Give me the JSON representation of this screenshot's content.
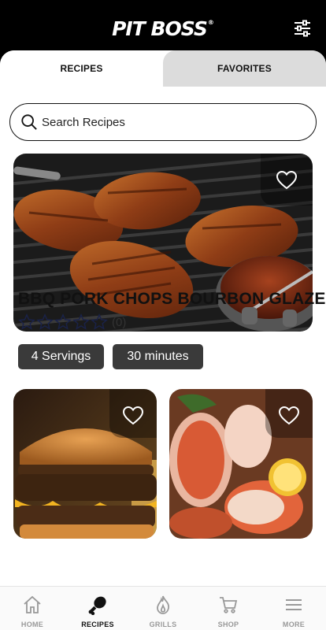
{
  "header": {
    "logo_text": "PIT BOSS",
    "logo_mark": "®",
    "filter_icon": "sliders-icon"
  },
  "tabs": [
    {
      "label": "RECIPES",
      "active": true
    },
    {
      "label": "FAVORITES",
      "active": false
    }
  ],
  "search": {
    "placeholder": "Search Recipes",
    "value": ""
  },
  "featured": {
    "title": "BBQ PORK CHOPS BOURBON GLAZE",
    "rating_count": "(0)",
    "stars": 0,
    "servings": "4 Servings",
    "time": "30 minutes",
    "favorited": false
  },
  "cards": [
    {
      "image": "burger",
      "favorited": false
    },
    {
      "image": "lobster",
      "favorited": false
    }
  ],
  "bottom_nav": [
    {
      "label": "HOME",
      "icon": "home-icon",
      "active": false
    },
    {
      "label": "RECIPES",
      "icon": "drumstick-icon",
      "active": true
    },
    {
      "label": "GRILLS",
      "icon": "flame-icon",
      "active": false
    },
    {
      "label": "SHOP",
      "icon": "cart-icon",
      "active": false
    },
    {
      "label": "MORE",
      "icon": "menu-icon",
      "active": false
    }
  ],
  "colors": {
    "chip_bg": "#3a3a3a",
    "star_outline": "#1a2248",
    "inactive_tab": "#dcdcdc"
  }
}
